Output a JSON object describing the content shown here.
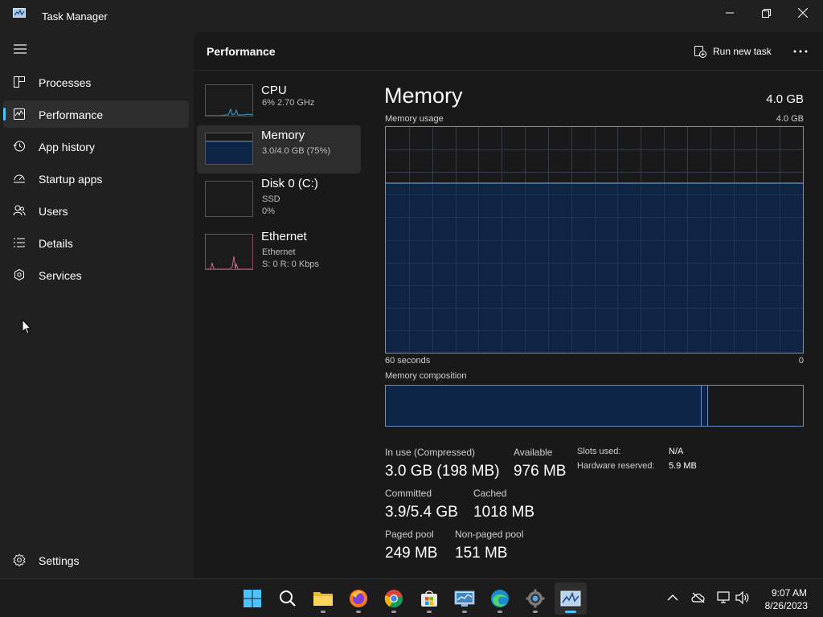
{
  "window": {
    "title": "Task Manager"
  },
  "nav": {
    "items": [
      {
        "label": "Processes",
        "icon": "processes-icon"
      },
      {
        "label": "Performance",
        "icon": "performance-icon"
      },
      {
        "label": "App history",
        "icon": "history-icon"
      },
      {
        "label": "Startup apps",
        "icon": "startup-icon"
      },
      {
        "label": "Users",
        "icon": "users-icon"
      },
      {
        "label": "Details",
        "icon": "details-icon"
      },
      {
        "label": "Services",
        "icon": "services-icon"
      }
    ],
    "active": "Performance",
    "settings_label": "Settings"
  },
  "header": {
    "title": "Performance",
    "run_new_task": "Run new task"
  },
  "resources": [
    {
      "name": "CPU",
      "line1": "6%  2.70 GHz",
      "line2": ""
    },
    {
      "name": "Memory",
      "line1": "3.0/4.0 GB (75%)",
      "line2": ""
    },
    {
      "name": "Disk 0 (C:)",
      "line1": "SSD",
      "line2": "0%"
    },
    {
      "name": "Ethernet",
      "line1": "Ethernet",
      "line2": "S: 0  R: 0 Kbps"
    }
  ],
  "detail": {
    "title": "Memory",
    "total": "4.0 GB",
    "usage_label": "Memory usage",
    "usage_max": "4.0 GB",
    "time_span": "60 seconds",
    "axis_min": "0",
    "composition_label": "Memory composition",
    "usage_fraction": 0.75,
    "composition": {
      "in_use_fraction": 0.755,
      "modified_fraction": 0.012,
      "standby_fraction": 0.233
    },
    "stats": {
      "in_use_label": "In use (Compressed)",
      "in_use_value": "3.0 GB (198 MB)",
      "available_label": "Available",
      "available_value": "976 MB",
      "committed_label": "Committed",
      "committed_value": "3.9/5.4 GB",
      "cached_label": "Cached",
      "cached_value": "1018 MB",
      "paged_label": "Paged pool",
      "paged_value": "249 MB",
      "nonpaged_label": "Non-paged pool",
      "nonpaged_value": "151 MB",
      "slots_label": "Slots used:",
      "slots_value": "N/A",
      "hw_label": "Hardware reserved:",
      "hw_value": "5.9 MB"
    }
  },
  "taskbar": {
    "apps": [
      "start-icon",
      "search-icon",
      "file-explorer-icon",
      "firefox-icon",
      "chrome-icon",
      "store-icon",
      "control-panel-icon",
      "edge-icon",
      "settings-gear-icon",
      "task-manager-icon"
    ],
    "time": "9:07 AM",
    "date": "8/26/2023"
  },
  "colors": {
    "accent": "#4cc2ff",
    "memory_line": "#6c93c7",
    "memory_fill": "#0e2447",
    "cpu_line": "#3aa0c8",
    "ethernet_line": "#d0668a"
  }
}
